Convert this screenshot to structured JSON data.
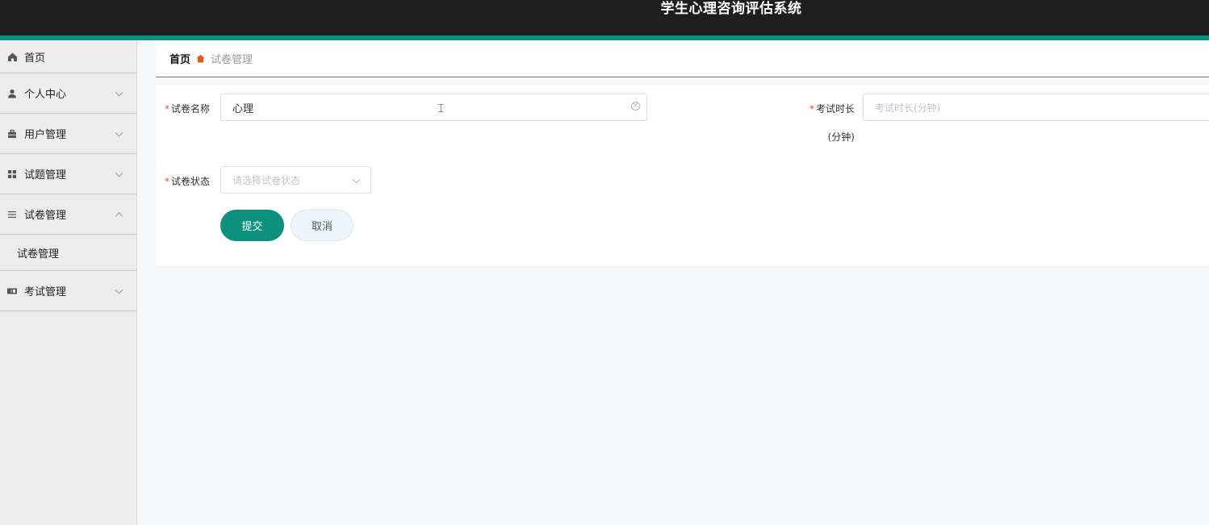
{
  "header": {
    "title": "学生心理咨询评估系统"
  },
  "sidebar": {
    "items": [
      {
        "label": "首页",
        "icon": "home-icon"
      },
      {
        "label": "个人中心",
        "icon": "user-icon"
      },
      {
        "label": "用户管理",
        "icon": "users-icon"
      },
      {
        "label": "试题管理",
        "icon": "grid-icon"
      },
      {
        "label": "试卷管理",
        "icon": "list-icon",
        "expanded": true,
        "children": [
          {
            "label": "试卷管理"
          }
        ]
      },
      {
        "label": "考试管理",
        "icon": "exam-icon"
      }
    ]
  },
  "breadcrumb": {
    "home": "首页",
    "current": "试卷管理"
  },
  "form": {
    "name": {
      "label": "试卷名称",
      "value": "心理"
    },
    "duration": {
      "label": "考试时长",
      "label_unit": "(分钟)",
      "placeholder": "考试时长(分钟)"
    },
    "status": {
      "label": "试卷状态",
      "placeholder": "请选择试卷状态"
    },
    "submit_label": "提交",
    "cancel_label": "取消"
  },
  "colors": {
    "accent": "#0d8f7e",
    "header_bg": "#1e1e1e",
    "required": "#e8473b"
  }
}
